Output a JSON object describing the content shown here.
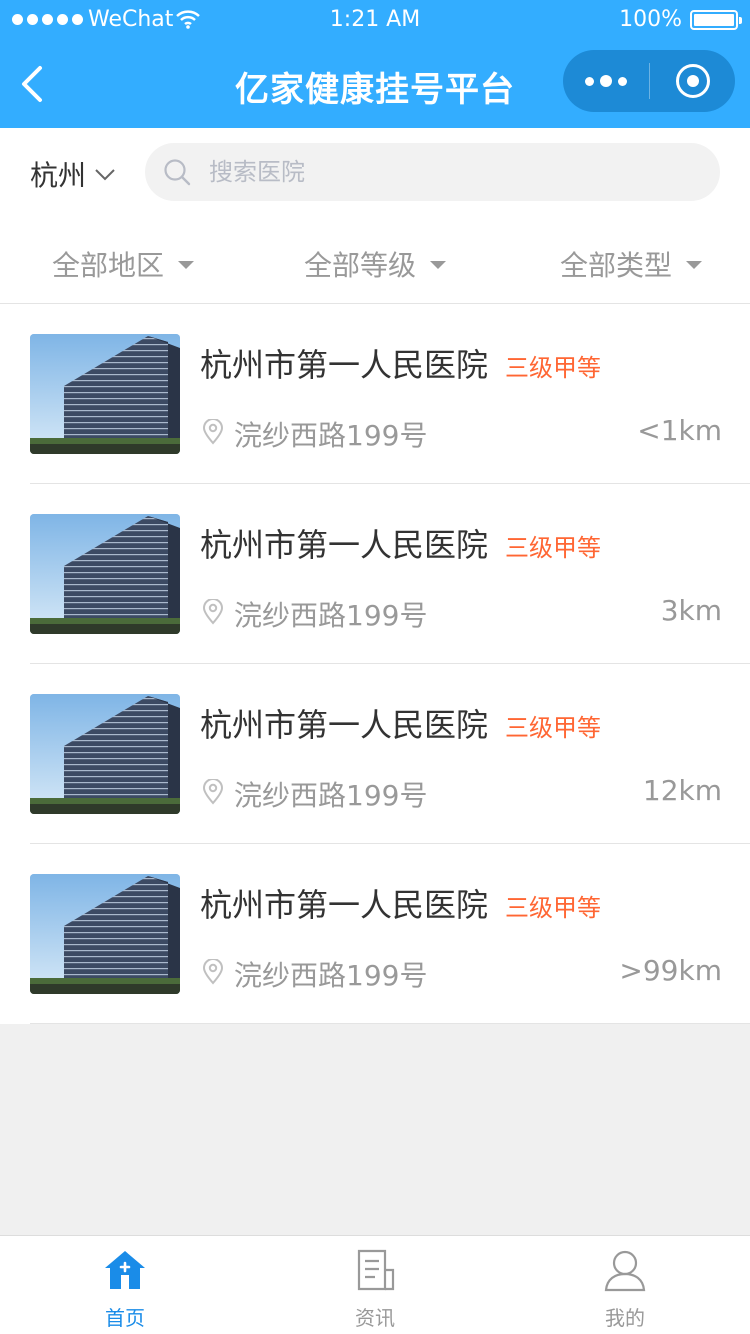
{
  "status_bar": {
    "carrier": "WeChat",
    "time": "1:21 AM",
    "battery": "100%"
  },
  "nav": {
    "title": "亿家健康挂号平台",
    "back_icon": "chevron-left-icon",
    "more_icon": "more-dots-icon",
    "close_icon": "target-close-icon"
  },
  "search": {
    "city": "杭州",
    "placeholder": "搜索医院"
  },
  "filters": [
    "全部地区",
    "全部等级",
    "全部类型"
  ],
  "hospitals": [
    {
      "name": "杭州市第一人民医院",
      "level": "三级甲等",
      "address": "浣纱西路199号",
      "distance": "<1km"
    },
    {
      "name": "杭州市第一人民医院",
      "level": "三级甲等",
      "address": "浣纱西路199号",
      "distance": "3km"
    },
    {
      "name": "杭州市第一人民医院",
      "level": "三级甲等",
      "address": "浣纱西路199号",
      "distance": "12km"
    },
    {
      "name": "杭州市第一人民医院",
      "level": "三级甲等",
      "address": "浣纱西路199号",
      "distance": ">99km"
    }
  ],
  "tabbar": {
    "items": [
      {
        "label": "首页",
        "icon": "home-icon",
        "active": true
      },
      {
        "label": "资讯",
        "icon": "news-icon",
        "active": false
      },
      {
        "label": "我的",
        "icon": "user-icon",
        "active": false
      }
    ]
  },
  "colors": {
    "primary": "#33ADFF",
    "accent": "#FF6633",
    "text": "#333333",
    "muted": "#999999",
    "placeholder": "#B8BCC6",
    "search_bg": "#F2F2F2",
    "divider": "#E4E4E4",
    "tab_active": "#1A8CE8"
  }
}
